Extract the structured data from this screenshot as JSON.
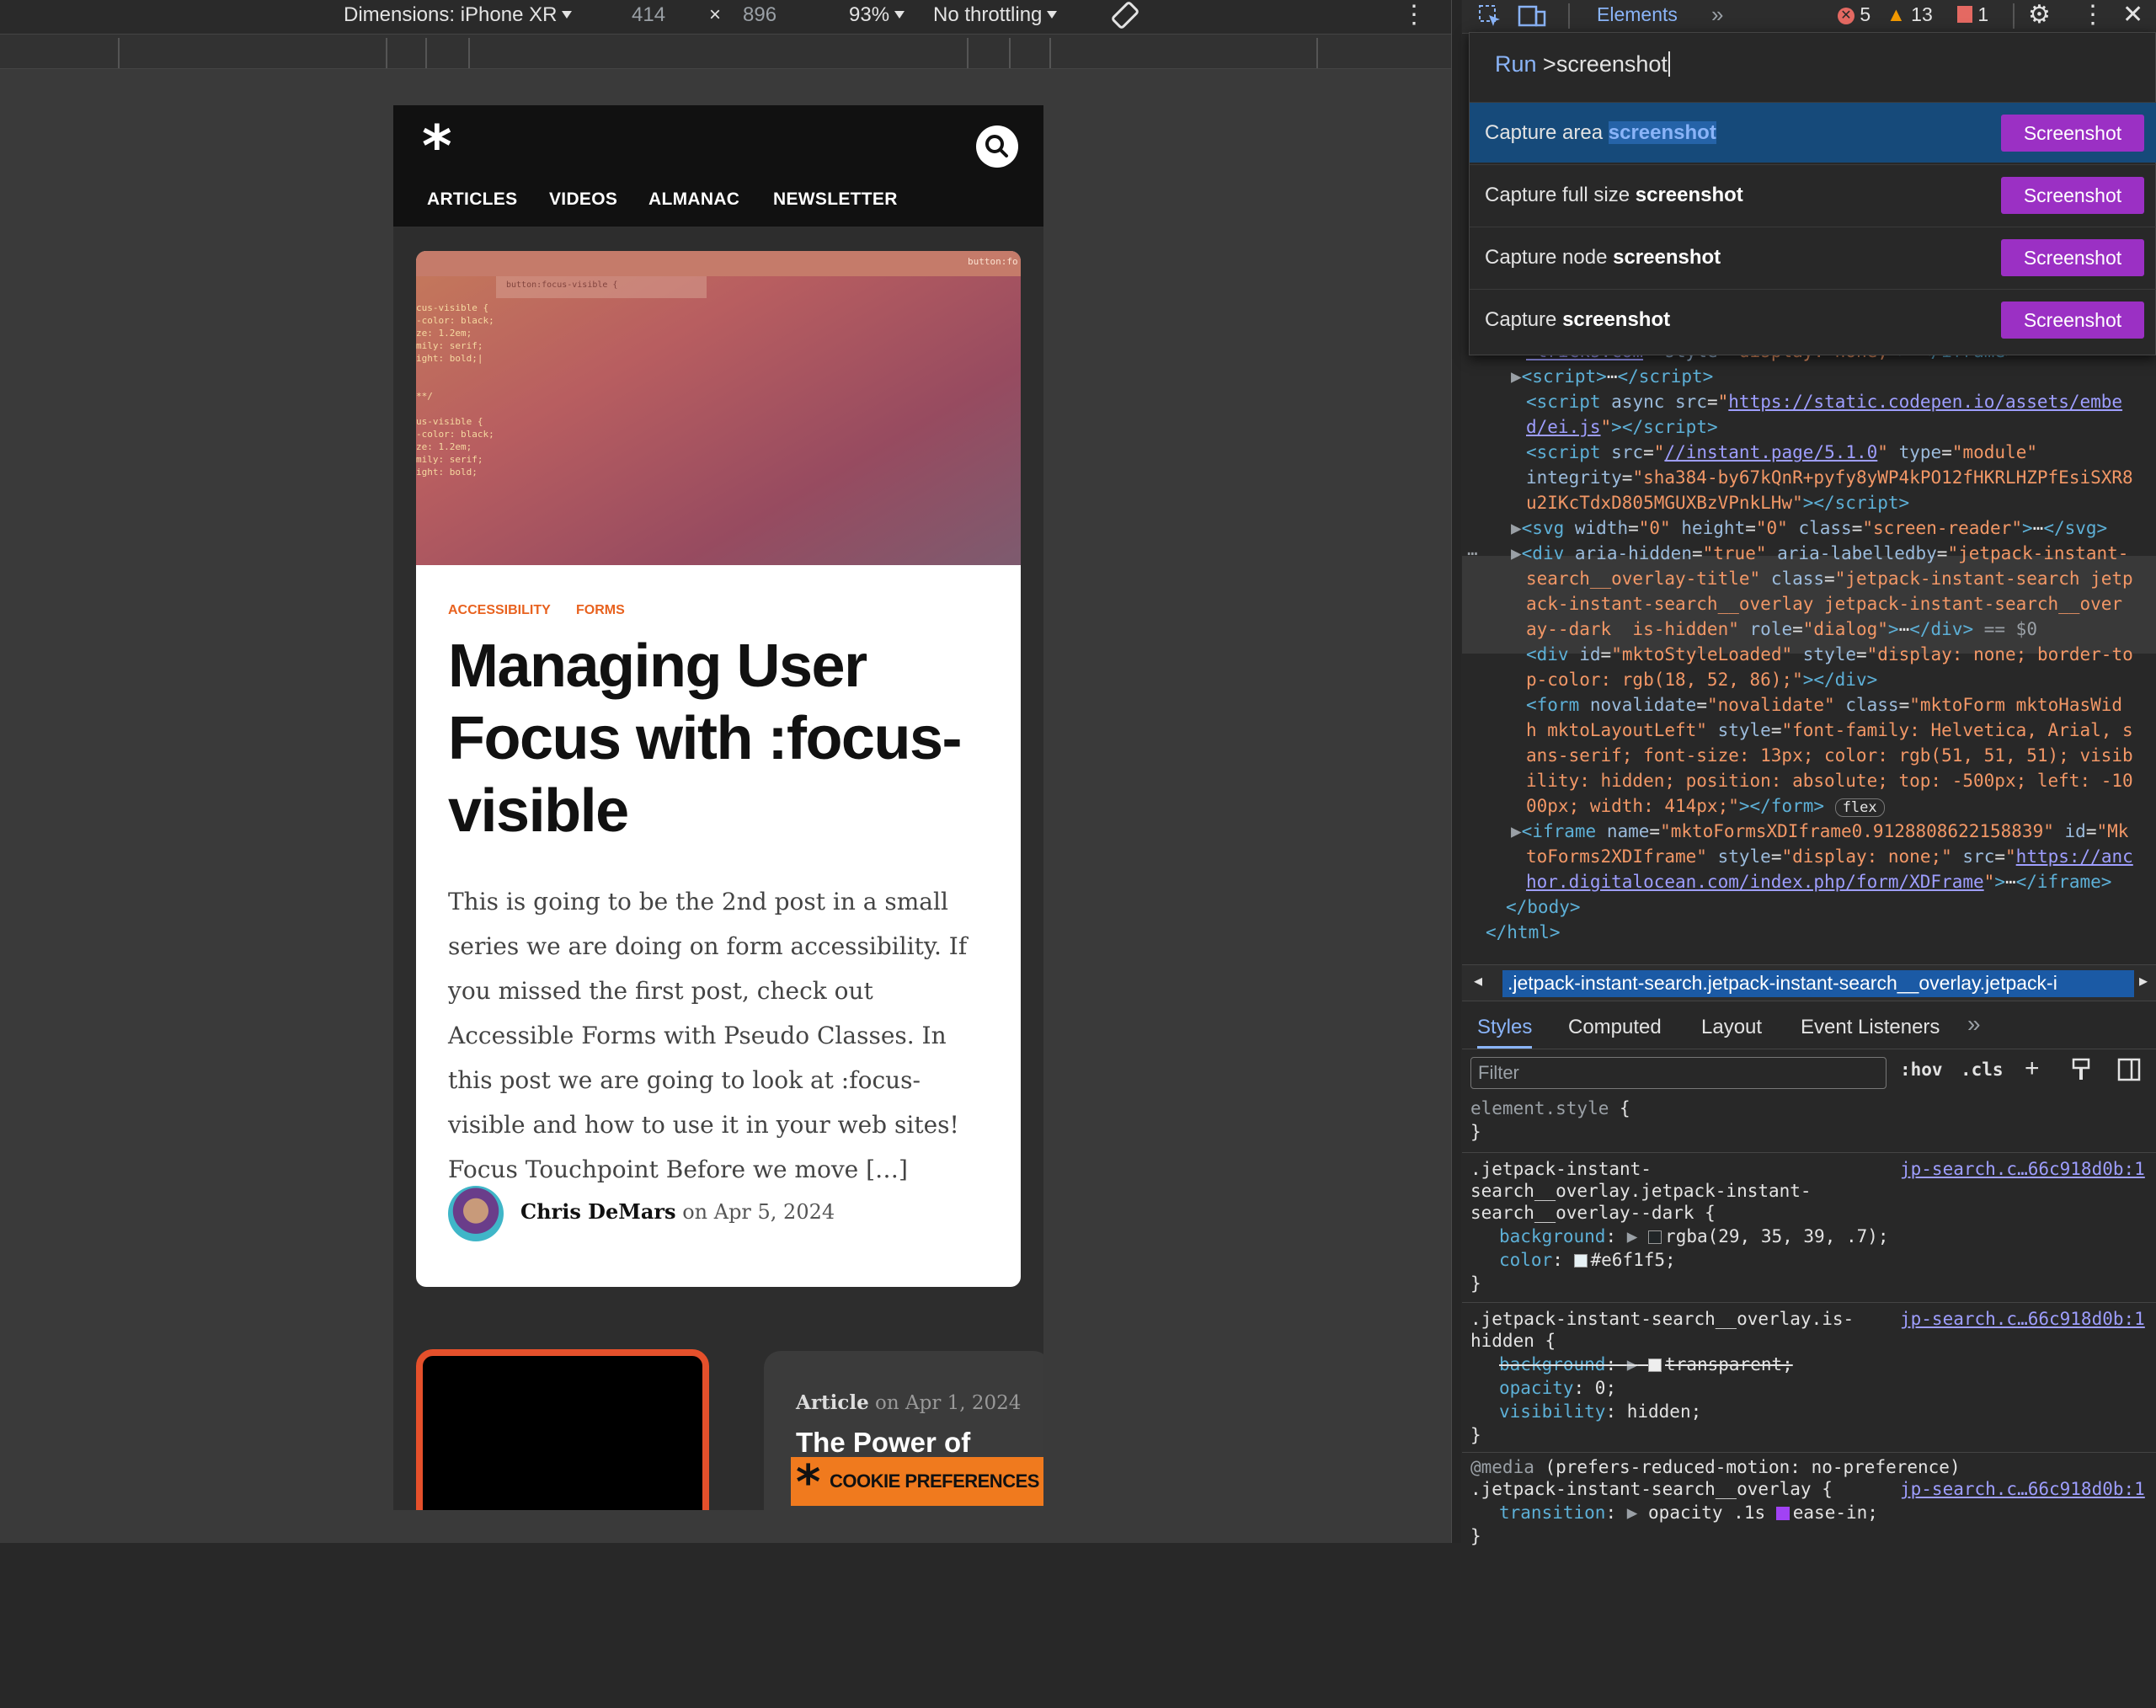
{
  "device_toolbar": {
    "dimensions_label": "Dimensions: iPhone XR",
    "width": "414",
    "times": "×",
    "height": "896",
    "zoom": "93%",
    "throttling": "No throttling"
  },
  "site": {
    "logo": "*",
    "nav": [
      "ARTICLES",
      "VIDEOS",
      "ALMANAC",
      "NEWSLETTER"
    ],
    "article": {
      "hero_tab": "button:focus-visible {",
      "hero_corner": "button:fo",
      "hero_code": "cus-visible {\n-color: black;\nze: 1.2em;\nmily: serif;\night: bold;|\n\n\n**/\n\nus-visible {\n-color: black;\nze: 1.2em;\nmily: serif;\night: bold;",
      "tags": [
        "ACCESSIBILITY",
        "FORMS"
      ],
      "title": "Managing User Focus with :focus-visible",
      "excerpt": "This is going to be the 2nd post in a small series we are doing on form accessibility. If you missed the first post, check out Accessible Forms with Pseudo Classes. In this post we are going to look at :focus-visible and how to use it in your web sites! Focus Touchpoint Before we move […]",
      "author": "Chris DeMars",
      "date_prefix": "on",
      "date": "Apr 5, 2024"
    },
    "next_card": {
      "type": "Article",
      "date_prefix": "on",
      "date": "Apr 1, 2024",
      "title": "The Power of"
    },
    "cookie_label": "COOKIE PREFERENCES"
  },
  "devtools": {
    "tab": "Elements",
    "errors": "5",
    "warnings": "13",
    "issues": "1",
    "command_menu": {
      "run_prefix": "Run",
      "query": ">screenshot",
      "items": [
        {
          "pre": "Capture area ",
          "bold": "screenshot",
          "button": "Screenshot"
        },
        {
          "pre": "Capture full size ",
          "bold": "screenshot",
          "button": "Screenshot"
        },
        {
          "pre": "Capture node ",
          "bold": "screenshot",
          "button": "Screenshot"
        },
        {
          "pre": "Capture ",
          "bold": "screenshot",
          "button": "Screenshot"
        }
      ]
    },
    "breadcrumb": ".jetpack-instant-search.jetpack-instant-search__overlay.jetpack-i",
    "style_tabs": [
      "Styles",
      "Computed",
      "Layout",
      "Event Listeners"
    ],
    "filter_placeholder": "Filter",
    "hov": ":hov",
    "cls": ".cls",
    "colors": {
      "accent": "#9b30c4",
      "selection": "#164a7a",
      "orange": "#f07a1e"
    }
  }
}
